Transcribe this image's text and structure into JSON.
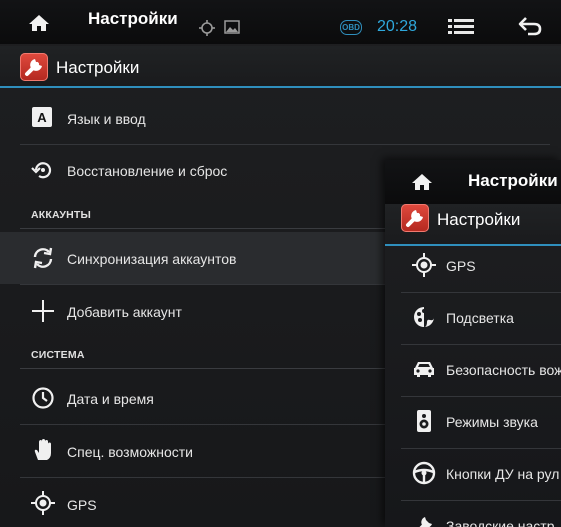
{
  "screen1": {
    "status": {
      "title": "Настройки",
      "obd_label": "OBD",
      "time": "20:28"
    },
    "app_title": "Настройки",
    "items": {
      "language": "Язык и ввод",
      "restore": "Восстановление и сброс",
      "sync": "Синхронизация аккаунтов",
      "add_account": "Добавить аккаунт",
      "datetime": "Дата и время",
      "accessibility": "Спец. возможности",
      "gps": "GPS"
    },
    "sections": {
      "accounts": "АККАУНТЫ",
      "system": "СИСТЕМА"
    }
  },
  "screen2": {
    "status": {
      "title": "Настройки"
    },
    "app_title": "Настройки",
    "items": {
      "gps": "GPS",
      "backlight": "Подсветка",
      "safety": "Безопасность вож",
      "sound": "Режимы звука",
      "steering": "Кнопки ДУ на рул",
      "factory": "Заводские настр"
    }
  },
  "colors": {
    "accent": "#2f8fbd",
    "app_icon": "#d33a2f",
    "background": "#1b1c1e"
  },
  "icons": [
    "home-icon",
    "gps-icon",
    "image-icon",
    "obd-icon",
    "menu-icon",
    "back-icon",
    "settings-app-icon",
    "keyboard-icon",
    "restore-icon",
    "sync-icon",
    "plus-icon",
    "clock-icon",
    "hand-icon",
    "backlight-icon",
    "car-icon",
    "speaker-icon",
    "steering-wheel-icon",
    "wrench-icon"
  ]
}
